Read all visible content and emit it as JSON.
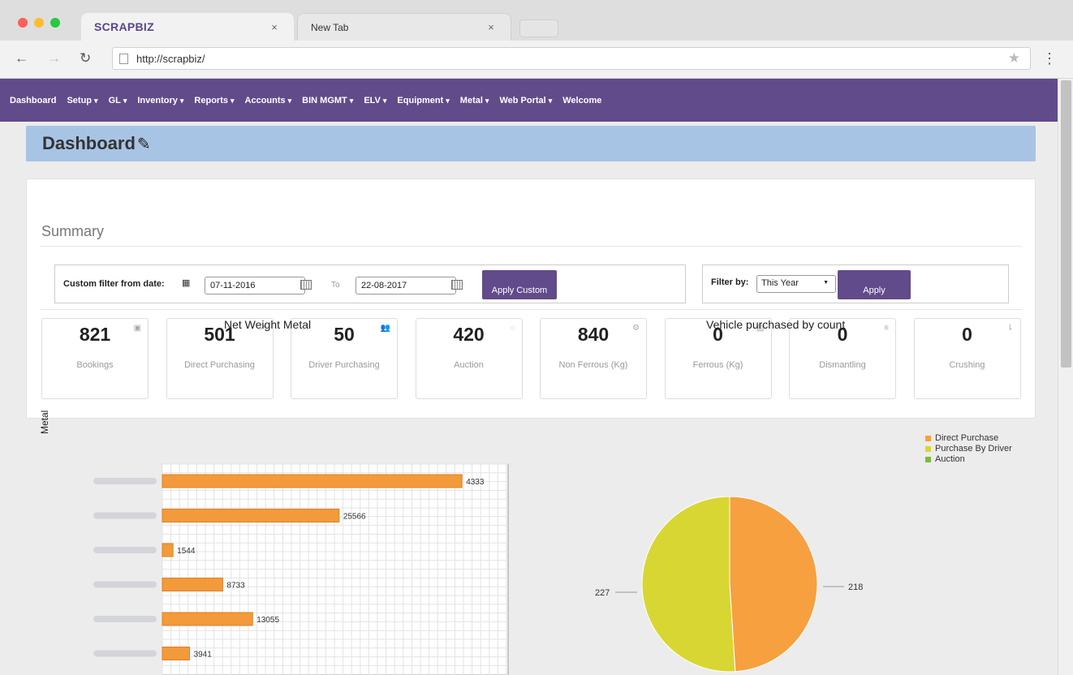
{
  "browser": {
    "tabs": [
      {
        "title": "SCRAPBIZ",
        "close": "×"
      },
      {
        "title": "New Tab",
        "close": "×"
      }
    ],
    "url": "http://scrapbiz/",
    "back_icon": "arrow-left-icon",
    "forward_icon": "arrow-right-icon",
    "reload_icon": "reload-icon",
    "star_icon": "star-icon",
    "menu_icon": "kebab-menu-icon"
  },
  "nav": {
    "items": [
      {
        "label": "Dashboard",
        "dropdown": false
      },
      {
        "label": "Setup",
        "dropdown": true
      },
      {
        "label": "GL",
        "dropdown": true
      },
      {
        "label": "Inventory",
        "dropdown": true
      },
      {
        "label": "Reports",
        "dropdown": true
      },
      {
        "label": "Accounts",
        "dropdown": true
      },
      {
        "label": "BIN MGMT",
        "dropdown": true
      },
      {
        "label": "ELV",
        "dropdown": true
      },
      {
        "label": "Equipment",
        "dropdown": true
      },
      {
        "label": "Metal",
        "dropdown": true
      },
      {
        "label": "Web Portal",
        "dropdown": true
      },
      {
        "label": "Welcome",
        "dropdown": false
      }
    ],
    "caret": "▾"
  },
  "page": {
    "title": "Dashboard",
    "edit_icon": "pencil-icon"
  },
  "summary": {
    "title": "Summary",
    "custom_filter": {
      "label": "Custom filter from date:",
      "from_value": "07-11-2016",
      "to_label": "To",
      "to_value": "22-08-2017",
      "button": "Apply Custom"
    },
    "preset_filter": {
      "label": "Filter by:",
      "selected": "This Year",
      "button": "Apply"
    },
    "cards": [
      {
        "value": "821",
        "label": "Bookings",
        "icon": "square-icon"
      },
      {
        "value": "501",
        "label": "Direct Purchasing",
        "icon": "external-link-icon"
      },
      {
        "value": "50",
        "label": "Driver Purchasing",
        "icon": "users-icon"
      },
      {
        "value": "420",
        "label": "Auction",
        "icon": "comment-icon"
      },
      {
        "value": "840",
        "label": "Non Ferrous (Kg)",
        "icon": "cogs-icon"
      },
      {
        "value": "0",
        "label": "Ferrous (Kg)",
        "icon": "image-icon"
      },
      {
        "value": "0",
        "label": "Dismantling",
        "icon": "sort-list-icon"
      },
      {
        "value": "0",
        "label": "Crushing",
        "icon": "sort-desc-icon"
      }
    ]
  },
  "chart_data": [
    {
      "type": "bar",
      "orientation": "horizontal",
      "title": "Net Weight Metal",
      "ylabel": "Metal",
      "xlabel": "",
      "categories": [
        "",
        "",
        "",
        "",
        "",
        ""
      ],
      "values": [
        43333,
        25566,
        1544,
        8733,
        13055,
        3941
      ],
      "value_labels": [
        "4333",
        "25566",
        "1544",
        "8733",
        "13055",
        "3941"
      ],
      "xlim": [
        0,
        50000
      ],
      "grid": true,
      "color": "#f39a3a"
    },
    {
      "type": "pie",
      "title": "Vehicle purchased by count",
      "slices": [
        {
          "name": "Direct Purchase",
          "value": 218,
          "color": "#f7a040"
        },
        {
          "name": "Purchase By Driver",
          "value": 227,
          "color": "#d8d633"
        },
        {
          "name": "Auction",
          "value": 0,
          "color": "#7bbd3a"
        }
      ],
      "legend_position": "right"
    }
  ]
}
